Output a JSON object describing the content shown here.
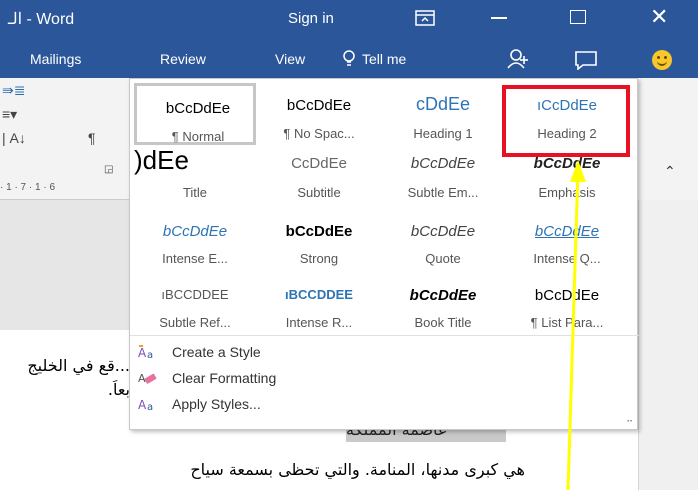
{
  "window": {
    "title": "الـ - Word",
    "sign_in": "Sign in"
  },
  "tabs": [
    {
      "label": "Mailings"
    },
    {
      "label": "Review"
    },
    {
      "label": "View"
    }
  ],
  "tell_me": "Tell me",
  "ruler": {
    "text": "· 1 · 7 · 1 · 6"
  },
  "styles_gallery": {
    "items": [
      {
        "sample": "bCcDdEe",
        "name": "¶ Normal"
      },
      {
        "sample": "bCcDdEe",
        "name": "¶ No Spac..."
      },
      {
        "sample": "cDdEe",
        "name": "Heading 1"
      },
      {
        "sample": "ıCcDdEe",
        "name": "Heading 2"
      },
      {
        "sample": ")dEe",
        "name": "Title"
      },
      {
        "sample": "CcDdEe",
        "name": "Subtitle"
      },
      {
        "sample": "bCcDdEe",
        "name": "Subtle Em..."
      },
      {
        "sample": "bCcDdEe",
        "name": "Emphasis"
      },
      {
        "sample": "bCcDdEe",
        "name": "Intense E..."
      },
      {
        "sample": "bCcDdEe",
        "name": "Strong"
      },
      {
        "sample": "bCcDdEe",
        "name": "Quote"
      },
      {
        "sample": "bCcDdEe",
        "name": "Intense Q..."
      },
      {
        "sample": "ıBCCDDEE",
        "name": "Subtle Ref..."
      },
      {
        "sample": "ıBCCDDEE",
        "name": "Intense R..."
      },
      {
        "sample": "bCcDdEe",
        "name": "Book Title"
      },
      {
        "sample": "bCcDdEe",
        "name": "¶ List Para..."
      }
    ],
    "menu": [
      {
        "label": "Create a Style"
      },
      {
        "label": "Clear Formatting"
      },
      {
        "label": "Apply Styles..."
      }
    ]
  },
  "document": {
    "line1": "...قع في الخليج",
    "line2": "بعاً.",
    "line3": "عاصمة المملكة",
    "line4": "هي كبرى مدنها، المنامة. والتي تحظى بسمعة سياح"
  },
  "colors": {
    "word_blue": "#2b579a",
    "highlight_red": "#e81123",
    "arrow_yellow": "#ffff00",
    "heading_blue": "#2e74b5"
  }
}
